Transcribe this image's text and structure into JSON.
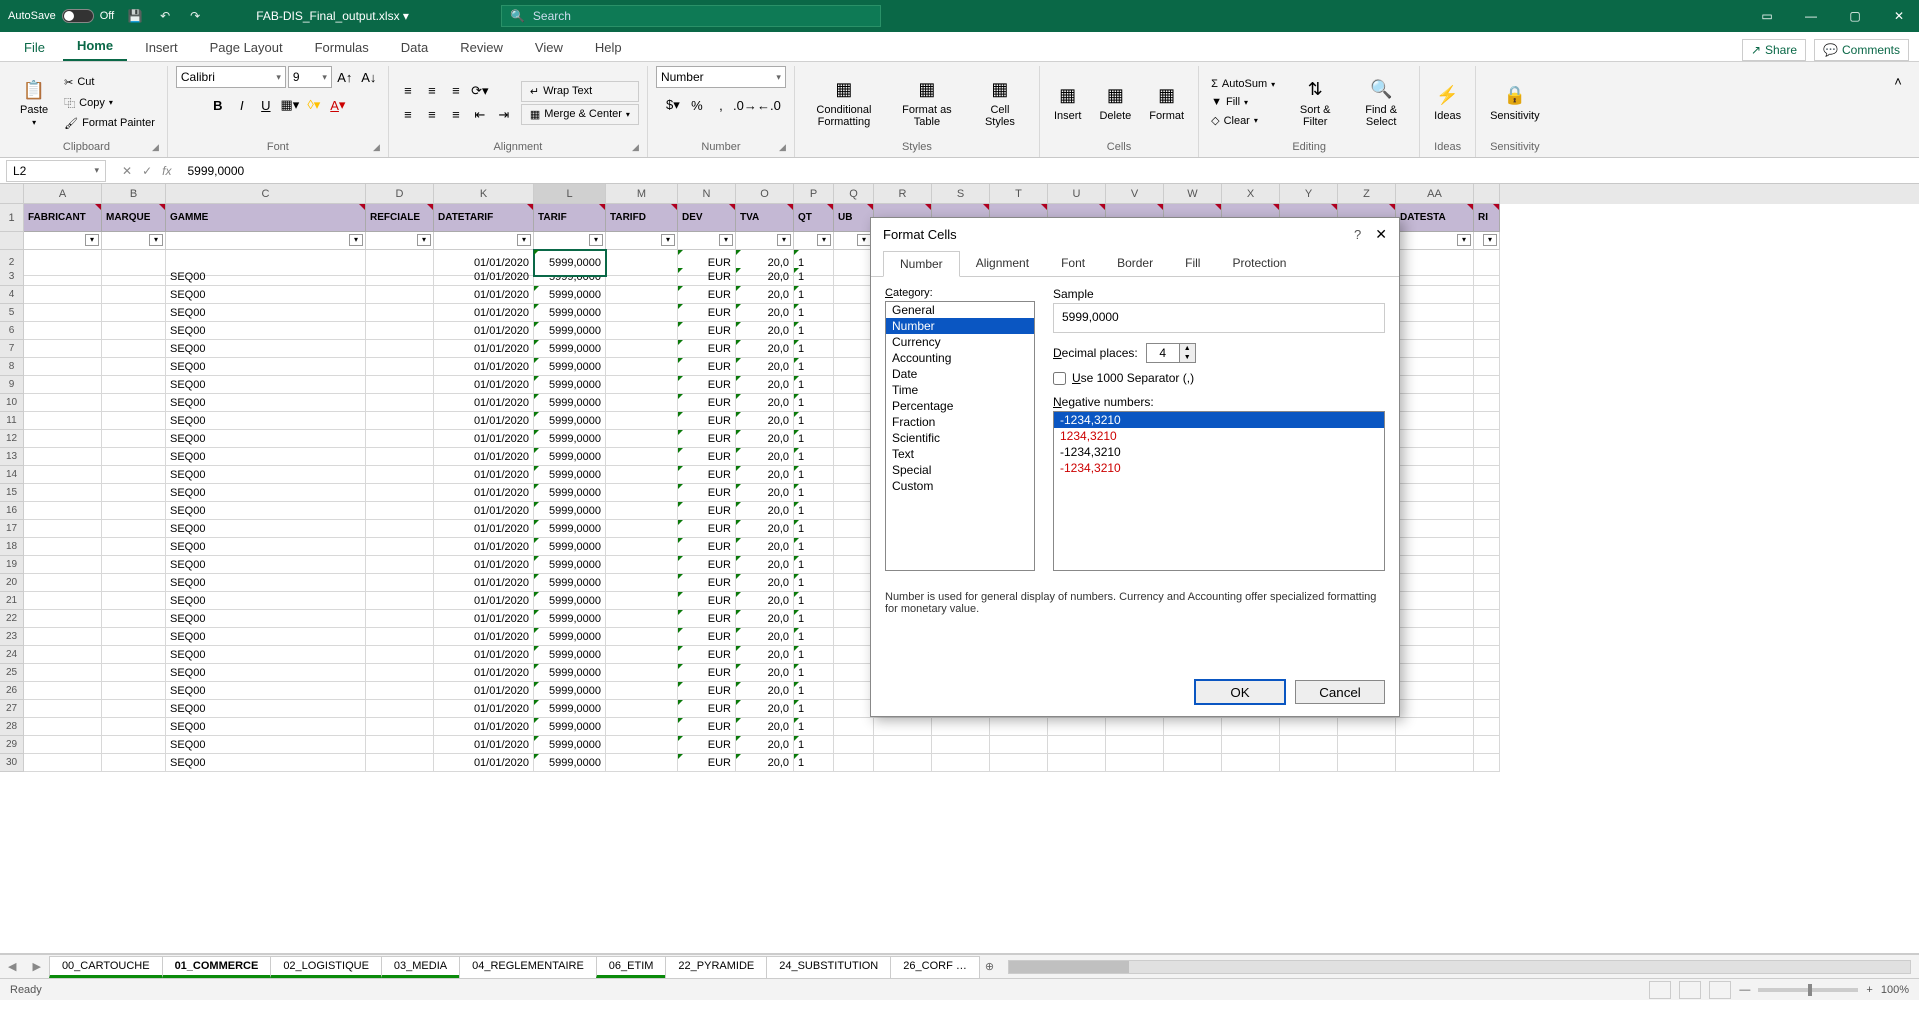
{
  "titlebar": {
    "autosave_label": "AutoSave",
    "autosave_state": "Off",
    "filename": "FAB-DIS_Final_output.xlsx ▾",
    "search_placeholder": "Search"
  },
  "tabs": {
    "file": "File",
    "home": "Home",
    "insert": "Insert",
    "page": "Page Layout",
    "formulas": "Formulas",
    "data": "Data",
    "review": "Review",
    "view": "View",
    "help": "Help",
    "share": "Share",
    "comments": "Comments"
  },
  "ribbon": {
    "clipboard": {
      "paste": "Paste",
      "cut": "Cut",
      "copy": "Copy",
      "fmt": "Format Painter",
      "label": "Clipboard"
    },
    "font": {
      "name": "Calibri",
      "size": "9",
      "label": "Font"
    },
    "alignment": {
      "wrap": "Wrap Text",
      "merge": "Merge & Center",
      "label": "Alignment"
    },
    "number": {
      "fmt": "Number",
      "label": "Number"
    },
    "styles": {
      "cond": "Conditional Formatting",
      "fat": "Format as Table",
      "cell": "Cell Styles",
      "label": "Styles"
    },
    "cells": {
      "insert": "Insert",
      "delete": "Delete",
      "format": "Format",
      "label": "Cells"
    },
    "editing": {
      "sum": "AutoSum",
      "fill": "Fill",
      "clear": "Clear",
      "sort": "Sort & Filter",
      "find": "Find & Select",
      "label": "Editing"
    },
    "ideas": {
      "ideas": "Ideas",
      "label": "Ideas"
    },
    "sens": {
      "sens": "Sensitivity",
      "label": "Sensitivity"
    }
  },
  "fbar": {
    "name": "L2",
    "value": "5999,0000"
  },
  "columns": [
    "A",
    "B",
    "C",
    "D",
    "K",
    "L",
    "M",
    "N",
    "O",
    "P",
    "Q",
    "R",
    "S",
    "T",
    "U",
    "V",
    "W",
    "X",
    "Y",
    "Z",
    "AA"
  ],
  "headers": [
    "FABRICANT",
    "MARQUE",
    "GAMME",
    "REFCIALE",
    "DATETARIF",
    "TARIF",
    "TARIFD",
    "DEV",
    "TVA",
    "QT",
    "UB",
    "",
    "",
    "",
    "",
    "",
    "",
    "",
    "",
    "",
    "DATESTA",
    "RI"
  ],
  "gamme_val": "SEQ00",
  "date_val": "01/01/2020",
  "tarif_val": "5999,0000",
  "dev_val": "EUR",
  "tva_val": "20,0",
  "qt_val": "1",
  "row_count": 29,
  "sheets": {
    "list": [
      "00_CARTOUCHE",
      "01_COMMERCE",
      "02_LOGISTIQUE",
      "03_MEDIA",
      "04_REGLEMENTAIRE",
      "06_ETIM",
      "22_PYRAMIDE",
      "24_SUBSTITUTION",
      "26_CORF …"
    ],
    "green": [
      0,
      1,
      2,
      3,
      5
    ],
    "active": 1
  },
  "status": {
    "ready": "Ready",
    "zoom": "100%"
  },
  "dialog": {
    "title": "Format Cells",
    "tabs": [
      "Number",
      "Alignment",
      "Font",
      "Border",
      "Fill",
      "Protection"
    ],
    "cat_label": "Category:",
    "categories": [
      "General",
      "Number",
      "Currency",
      "Accounting",
      "Date",
      "Time",
      "Percentage",
      "Fraction",
      "Scientific",
      "Text",
      "Special",
      "Custom"
    ],
    "cat_sel": 1,
    "sample_label": "Sample",
    "sample_val": "5999,0000",
    "dec_label": "Decimal places:",
    "dec_val": "4",
    "sep_label": "Use 1000 Separator (,)",
    "neg_label": "Negative numbers:",
    "neg_list": [
      "-1234,3210",
      "1234,3210",
      "-1234,3210",
      "-1234,3210"
    ],
    "desc": "Number is used for general display of numbers.  Currency and Accounting offer specialized formatting for monetary value.",
    "ok": "OK",
    "cancel": "Cancel"
  }
}
